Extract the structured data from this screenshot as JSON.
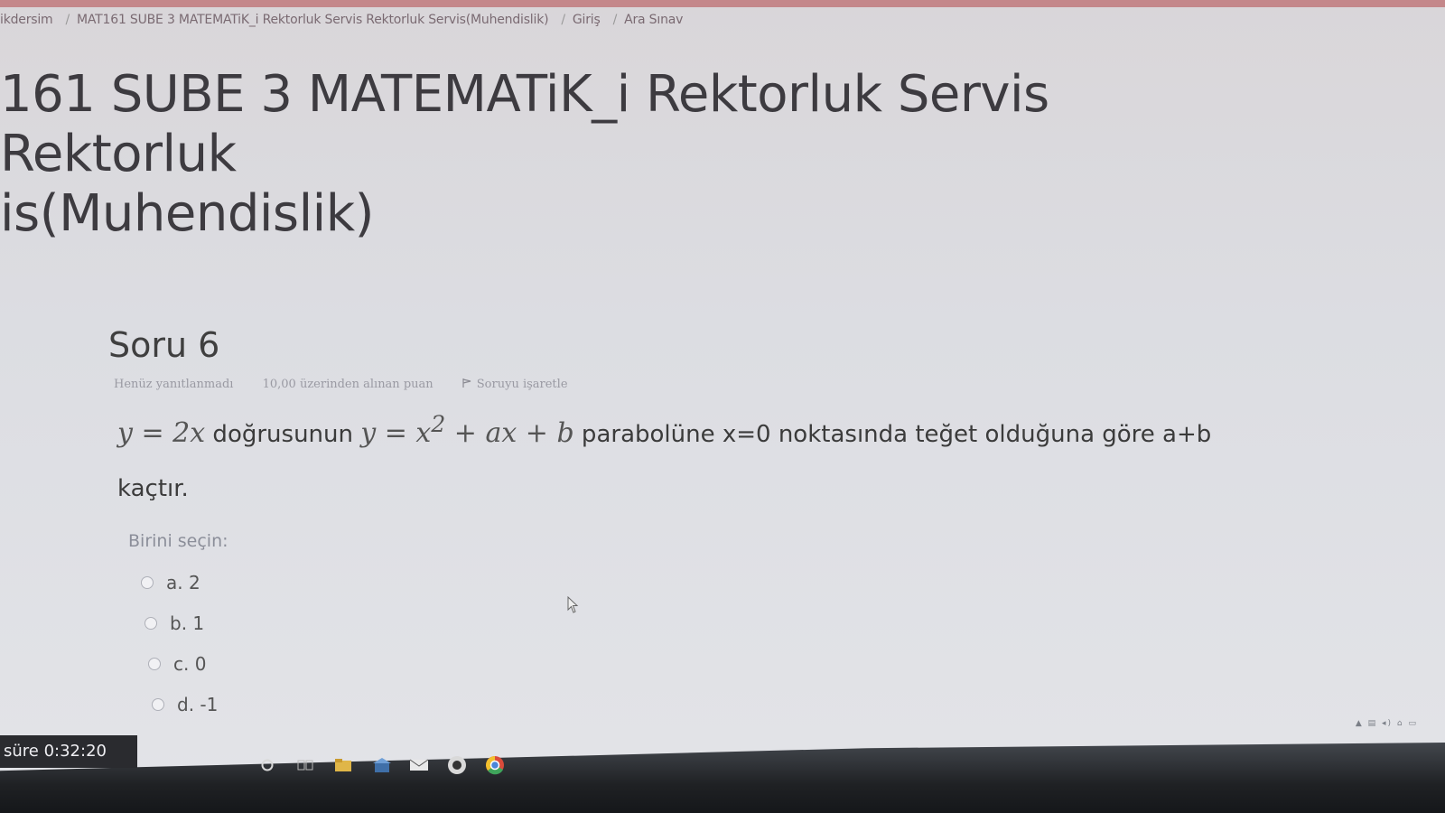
{
  "breadcrumb": {
    "items": [
      "ikdersim",
      "MAT161 SUBE 3 MATEMATiK_i Rektorluk Servis Rektorluk Servis(Muhendislik)",
      "Giriş",
      "Ara Sınav"
    ],
    "separator": "/"
  },
  "page_title": {
    "line1": "161 SUBE 3 MATEMATiK_i Rektorluk Servis Rektorluk",
    "line2": "is(Muhendislik)"
  },
  "question": {
    "number": "Soru 6",
    "status": "Henüz yanıtlanmadı",
    "points": "10,00 üzerinden alınan puan",
    "flag_label": "Soruyu işaretle",
    "text": {
      "math1": "y = 2x",
      "part1": " doğrusunun ",
      "math2": "y = x",
      "math2_sup": "2",
      "math3": " + ax + b",
      "part2": " parabolüne x=0 noktasında teğet olduğuna göre a+b",
      "part3": "kaçtır."
    }
  },
  "answer": {
    "prompt": "Birini seçin:",
    "options": [
      "a. 2",
      "b. 1",
      "c. 0",
      "d. -1"
    ]
  },
  "timer": {
    "text": "süre 0:32:20"
  },
  "taskbar": {
    "icons": [
      "search-icon",
      "task-view-icon",
      "file-explorer-icon",
      "store-icon",
      "mail-icon",
      "app-icon",
      "chrome-icon"
    ]
  },
  "colors": {
    "accent": "#c4878a",
    "taskbar": "#1f2124"
  }
}
